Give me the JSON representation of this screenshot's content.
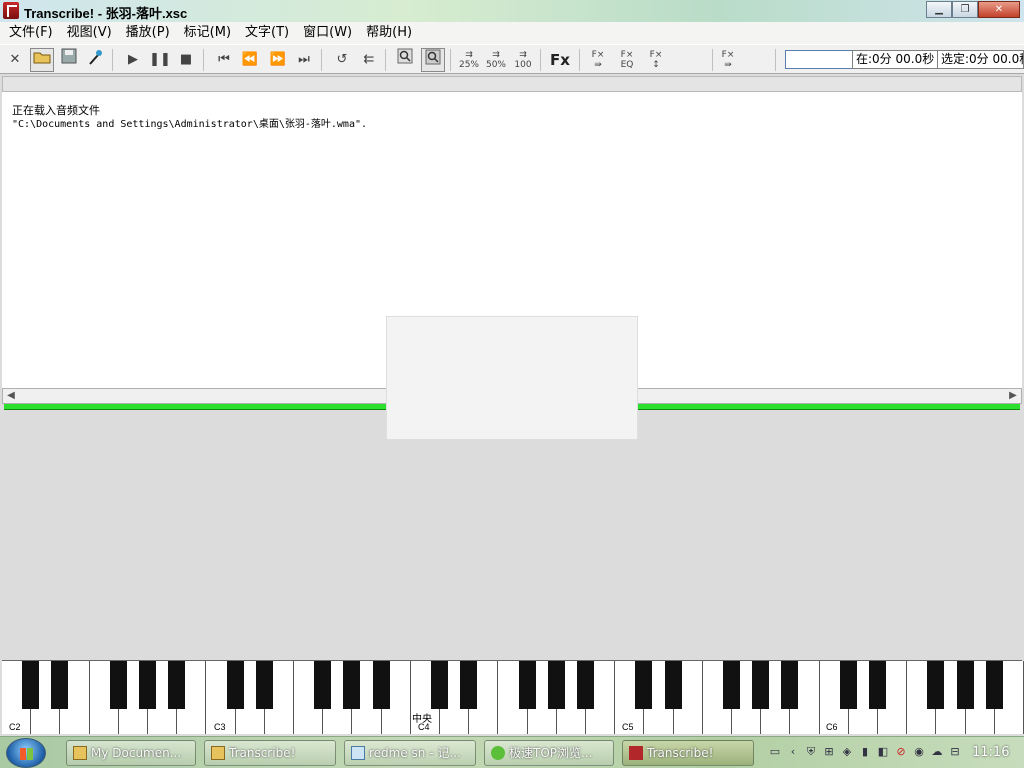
{
  "window": {
    "title": "Transcribe! - 张羽-落叶.xsc",
    "minimize": "▁",
    "restore": "❐",
    "close": "✕"
  },
  "menu": [
    "文件(F)",
    "视图(V)",
    "播放(P)",
    "标记(M)",
    "文字(T)",
    "窗口(W)",
    "帮助(H)"
  ],
  "toolbar": {
    "speed_25": "25%",
    "speed_50": "50%",
    "speed_100": "100",
    "fx": "Fx",
    "fx_eq": "EQ",
    "status_blank": "",
    "position": "在:0分 00.0秒",
    "selection": "选定:0分 00.0秒"
  },
  "message": {
    "line1": "正在载入音频文件",
    "line2": "\"C:\\Documents and Settings\\Administrator\\桌面\\张羽-落叶.wma\"."
  },
  "piano": {
    "labels": [
      "C2",
      "C3",
      "中央",
      "C4",
      "C5",
      "C6"
    ]
  },
  "taskbar": {
    "items": [
      "My Documen...",
      "Transcribe!",
      "redme sn - 记...",
      "极速TOP浏览...",
      "Transcribe!"
    ],
    "clock": "11:16"
  }
}
